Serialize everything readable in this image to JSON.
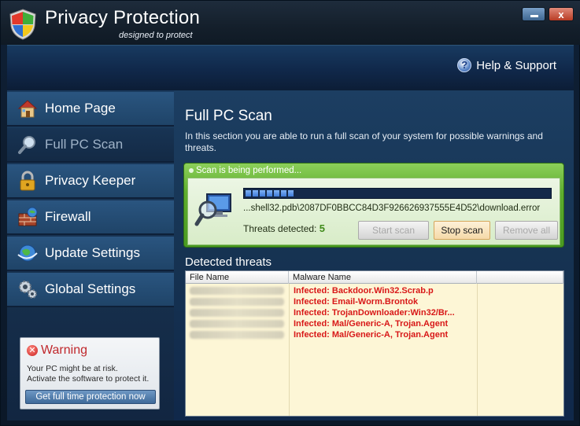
{
  "window": {
    "title": "Privacy Protection",
    "subtitle": "designed to protect",
    "close_label": "x"
  },
  "header": {
    "help_label": "Help & Support"
  },
  "sidebar": {
    "items": [
      {
        "label": "Home Page",
        "icon": "house-icon",
        "active": false
      },
      {
        "label": "Full PC Scan",
        "icon": "magnifier-icon",
        "active": true
      },
      {
        "label": "Privacy Keeper",
        "icon": "padlock-icon",
        "active": false
      },
      {
        "label": "Firewall",
        "icon": "brick-wall-globe-icon",
        "active": false
      },
      {
        "label": "Update Settings",
        "icon": "globe-update-icon",
        "active": false
      },
      {
        "label": "Global Settings",
        "icon": "gears-icon",
        "active": false
      }
    ],
    "warning": {
      "title": "Warning",
      "line1": "Your PC might be at risk.",
      "line2": "Activate the software to protect it.",
      "button": "Get full time protection now"
    }
  },
  "main": {
    "title": "Full PC Scan",
    "description": "In this section you are able to run a full scan of your system for possible warnings and threats.",
    "scan": {
      "status": "Scan is being performed...",
      "progress": 0.16,
      "current_file": "...shell32.pdb\\2087DF0BBCC84D3F926626937555E4D52\\download.error",
      "threats_label": "Threats detected:",
      "threats_count": "5",
      "start_label": "Start scan",
      "stop_label": "Stop scan",
      "remove_label": "Remove all"
    },
    "detected": {
      "title": "Detected threats",
      "columns": [
        "File Name",
        "Malware Name",
        ""
      ],
      "rows": [
        "Infected: Backdoor.Win32.Scrab.p",
        "Infected: Email-Worm.Brontok",
        "Infected: TrojanDownloader:Win32/Br...",
        "Infected: Mal/Generic-A, Trojan.Agent",
        "Infected: Mal/Generic-A, Trojan.Agent"
      ]
    }
  },
  "colors": {
    "accent": "#5fae2e",
    "threat_text": "#d81818",
    "warning_title": "#c0282c"
  }
}
